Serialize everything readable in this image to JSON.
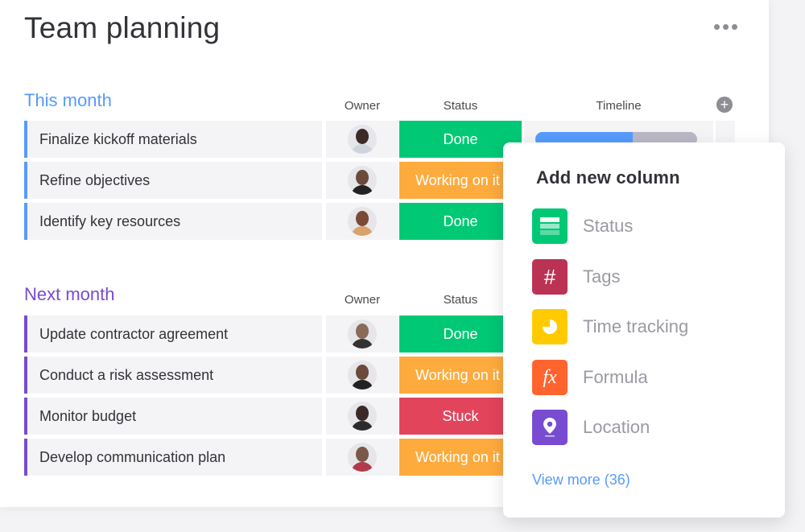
{
  "board": {
    "title": "Team planning",
    "more_icon": "more-horizontal-icon",
    "add_column_icon": "plus-circle-icon"
  },
  "columns": {
    "owner": "Owner",
    "status": "Status",
    "timeline": "Timeline"
  },
  "colors": {
    "done": "#00c875",
    "working": "#fdab3d",
    "stuck": "#e2445c",
    "this_month": "#579bfc",
    "next_month": "#784bd1"
  },
  "groups": [
    {
      "title": "This month",
      "color": "#579bfc",
      "items": [
        {
          "name": "Finalize kickoff materials",
          "status": "Done",
          "timeline_progress": 0.6
        },
        {
          "name": "Refine objectives",
          "status": "Working on it"
        },
        {
          "name": "Identify key resources",
          "status": "Done"
        }
      ]
    },
    {
      "title": "Next month",
      "color": "#784bd1",
      "items": [
        {
          "name": "Update contractor agreement",
          "status": "Done"
        },
        {
          "name": "Conduct a risk assessment",
          "status": "Working on it"
        },
        {
          "name": "Monitor budget",
          "status": "Stuck"
        },
        {
          "name": "Develop communication plan",
          "status": "Working on it"
        }
      ]
    }
  ],
  "popup": {
    "title": "Add new column",
    "items": [
      {
        "label": "Status",
        "icon": "status-column-icon",
        "color": "#00c875"
      },
      {
        "label": "Tags",
        "icon": "hash-icon",
        "glyph": "#",
        "color": "#bb3354"
      },
      {
        "label": "Time tracking",
        "icon": "clock-icon",
        "color": "#ffcb00"
      },
      {
        "label": "Formula",
        "icon": "function-icon",
        "glyph": "fx",
        "color": "#ff642e"
      },
      {
        "label": "Location",
        "icon": "map-pin-icon",
        "color": "#784bd1"
      }
    ],
    "view_more": "View more (36)"
  }
}
